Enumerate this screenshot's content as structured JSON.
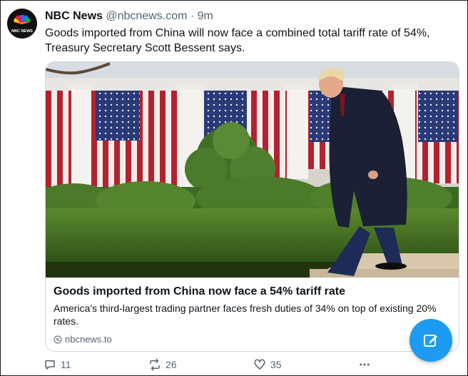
{
  "tweet": {
    "author_name": "NBC News",
    "handle": "@nbcnews.com",
    "separator": "·",
    "time": "9m",
    "text": "Goods imported from China will now face a combined total tariff rate of 54%, Treasury Secretary Scott Bessent says."
  },
  "card": {
    "title": "Goods imported from China now face a 54% tariff rate",
    "description": "America's third-largest trading partner faces fresh duties of 34% on top of existing 20% rates.",
    "domain": "nbcnews.to"
  },
  "actions": {
    "replies": "11",
    "reposts": "26",
    "likes": "35"
  },
  "colors": {
    "accent": "#1d9bf0",
    "secondary_text": "#536471",
    "border": "#cfd9de"
  },
  "icons": {
    "avatar": "nbc-peacock-logo",
    "reply": "reply-icon",
    "repost": "repost-icon",
    "like": "heart-icon",
    "more": "more-icon",
    "link": "link-icon",
    "compose": "compose-icon"
  }
}
